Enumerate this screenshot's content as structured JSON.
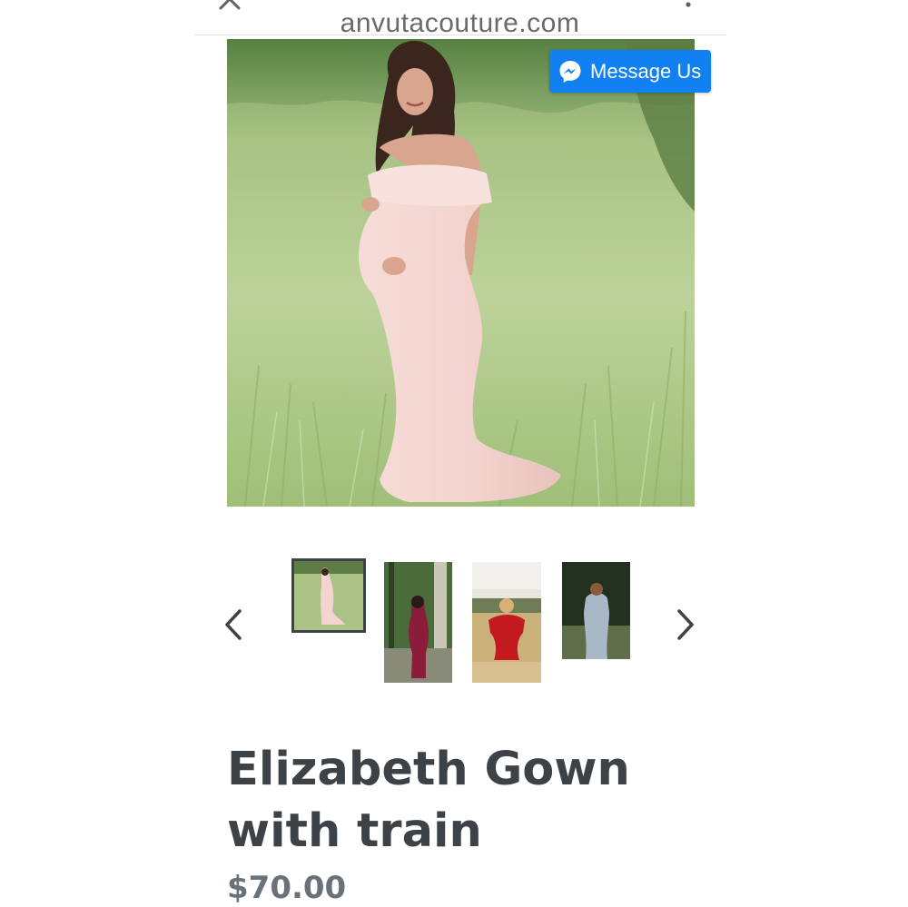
{
  "browser": {
    "url": "anvutacouture.com",
    "close_icon": "close-icon",
    "menu_icon": "kebab-menu-icon"
  },
  "messenger": {
    "label": "Message Us",
    "icon": "messenger-icon",
    "color": "#1181f1"
  },
  "gallery": {
    "main_image": "pregnant woman in a blush pink off-shoulder gown with train standing in a grass field",
    "thumbnails": [
      {
        "subject": "woman in blush pink gown in grass field",
        "selected": true
      },
      {
        "subject": "woman in burgundy gown in a forest",
        "selected": false
      },
      {
        "subject": "woman in red ruffle gown in a wheat field",
        "selected": false
      },
      {
        "subject": "woman in light grey-blue gown in a dark forest",
        "selected": false
      }
    ],
    "prev_icon": "chevron-left-icon",
    "next_icon": "chevron-right-icon"
  },
  "product": {
    "title": "Elizabeth Gown with train",
    "price": "$70.00"
  },
  "colors": {
    "title_text": "#3d4246",
    "price_text": "#69727b",
    "selected_thumb_border": "#3d4246"
  }
}
